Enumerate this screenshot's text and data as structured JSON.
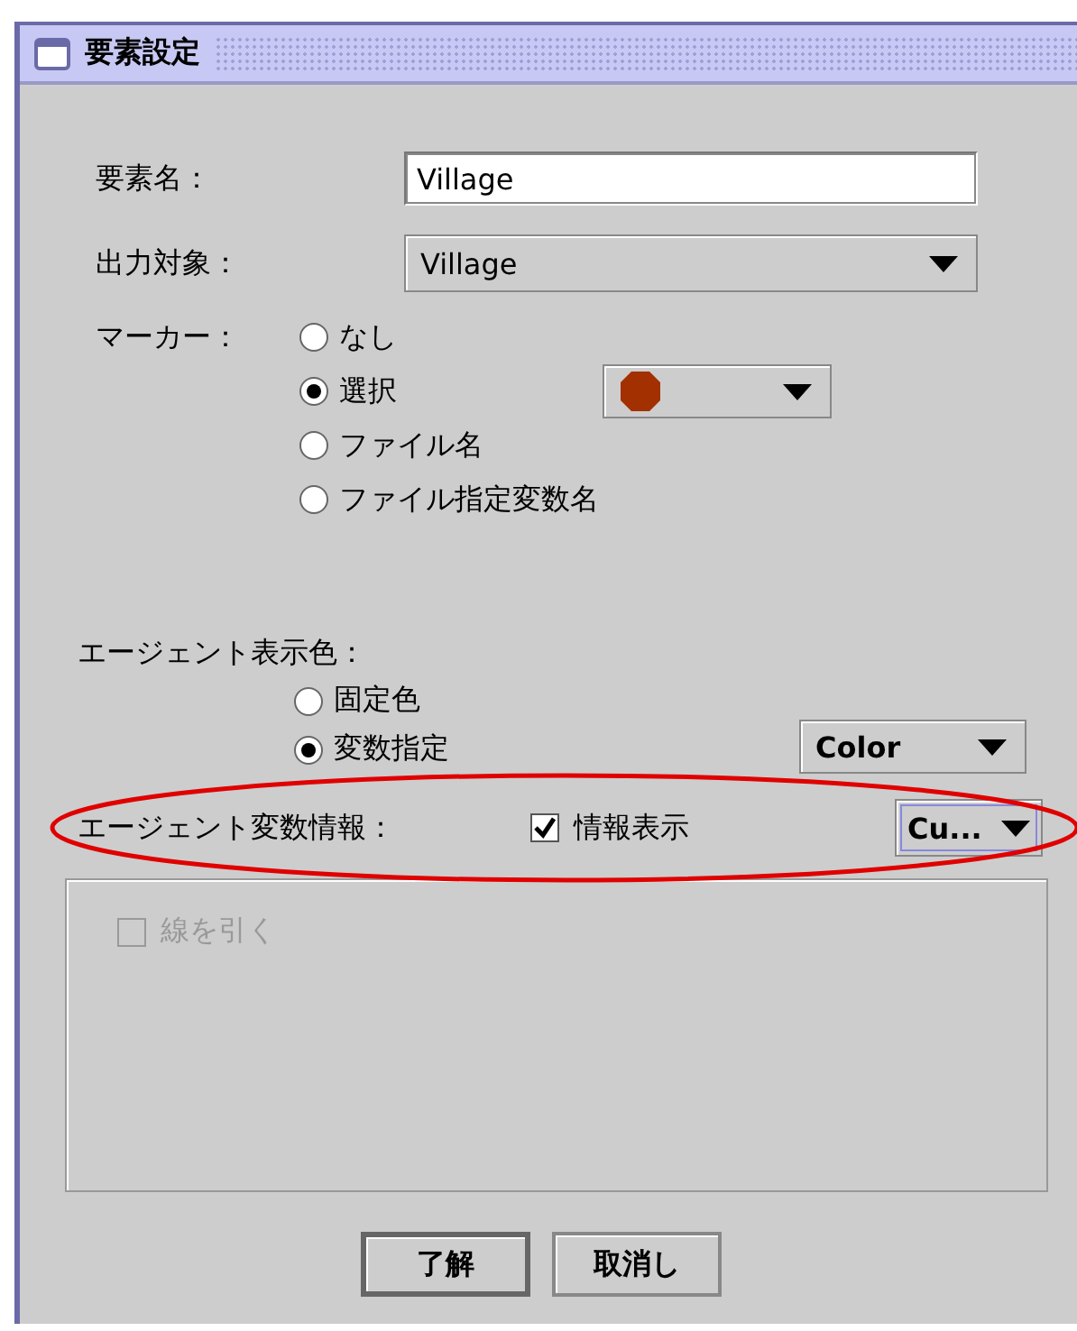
{
  "window": {
    "title": "要素設定"
  },
  "element_name": {
    "label": "要素名：",
    "value": "Village"
  },
  "output_target": {
    "label": "出力対象：",
    "value": "Village"
  },
  "marker": {
    "label": "マーカー：",
    "options": [
      {
        "label": "なし",
        "selected": false
      },
      {
        "label": "選択",
        "selected": true
      },
      {
        "label": "ファイル名",
        "selected": false
      },
      {
        "label": "ファイル指定変数名",
        "selected": false
      }
    ]
  },
  "agent_color": {
    "label": "エージェント表示色：",
    "options": [
      {
        "label": "固定色",
        "selected": false
      },
      {
        "label": "変数指定",
        "selected": true
      }
    ],
    "dropdown": "Color"
  },
  "agent_variable_info": {
    "label": "エージェント変数情報：",
    "checkbox": {
      "label": "情報表示",
      "checked": true
    },
    "dropdown": "Cu...",
    "highlighted": true
  },
  "line_panel": {
    "checkbox": {
      "label": "線を引く",
      "checked": false,
      "disabled": true
    }
  },
  "buttons": [
    {
      "label": "了解",
      "default": true
    },
    {
      "label": "取消し",
      "default": false
    }
  ]
}
